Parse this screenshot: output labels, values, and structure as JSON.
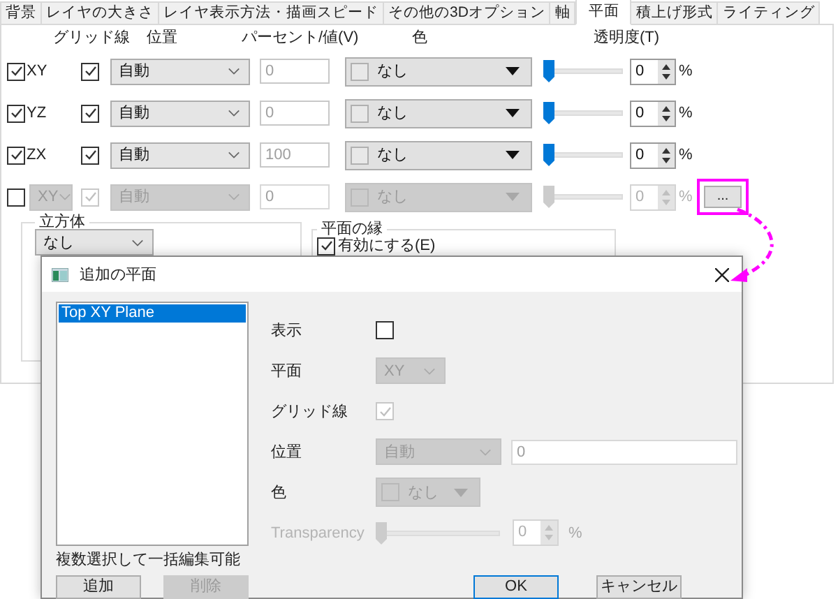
{
  "tabs": [
    {
      "label": "背景",
      "selected": false
    },
    {
      "label": "レイヤの大きさ",
      "selected": false
    },
    {
      "label": "レイヤ表示方法・描画スピード",
      "selected": false
    },
    {
      "label": "その他の3Dオプション",
      "selected": false
    },
    {
      "label": "軸",
      "selected": false
    },
    {
      "label": "平面",
      "selected": true
    },
    {
      "label": "積上げ形式",
      "selected": false
    },
    {
      "label": "ライティング",
      "selected": false
    }
  ],
  "column_headers": [
    "グリッド線",
    "位置",
    "パーセント/値(V)",
    "色",
    "透明度(T)"
  ],
  "planes": [
    {
      "kind": "axis",
      "label": "XY",
      "checked": true,
      "disabled": false,
      "grid_checked": true,
      "position": "自動",
      "value": "0",
      "color_value": "なし",
      "level": 0,
      "transparency": "0",
      "unit": "%"
    },
    {
      "kind": "axis",
      "label": "YZ",
      "checked": true,
      "disabled": false,
      "grid_checked": true,
      "position": "自動",
      "value": "0",
      "color_value": "なし",
      "level": 0,
      "transparency": "0",
      "unit": "%"
    },
    {
      "kind": "axis",
      "label": "ZX",
      "checked": true,
      "disabled": false,
      "grid_checked": true,
      "position": "自動",
      "value": "100",
      "color_value": "なし",
      "level": 0,
      "transparency": "0",
      "unit": "%"
    },
    {
      "kind": "extra",
      "label": "XY",
      "checked": false,
      "disabled": true,
      "grid_checked": true,
      "position": "自動",
      "value": "0",
      "color_value": "なし",
      "level": 0,
      "transparency": "0",
      "unit": "%",
      "more_button": {
        "label": "...",
        "highlighted": true
      }
    }
  ],
  "cube_group": {
    "title": "立方体",
    "value": "なし"
  },
  "edge_group": {
    "title": "平面の縁",
    "checkbox": {
      "label": "有効にする(E)",
      "checked": true
    }
  },
  "dialog": {
    "title": "追加の平面",
    "list": [
      {
        "label": "Top XY Plane",
        "selected": true
      }
    ],
    "hint": "複数選択して一括編集可能",
    "add_button": {
      "label": "追加",
      "disabled": false
    },
    "delete_button": {
      "label": "削除",
      "disabled": true
    },
    "fields": [
      {
        "kind": "checkbox",
        "label": "表示",
        "checked": false,
        "disabled": false
      },
      {
        "kind": "select",
        "label": "平面",
        "value": "XY",
        "disabled": true
      },
      {
        "kind": "checkbox",
        "label": "グリッド線",
        "checked": true,
        "disabled": true
      },
      {
        "kind": "select_input",
        "label": "位置",
        "value": "自動",
        "input": "0",
        "disabled": true
      },
      {
        "kind": "color",
        "label": "色",
        "value": "なし",
        "disabled": true
      },
      {
        "kind": "slider",
        "label": "Transparency",
        "level": 0,
        "value": "0",
        "unit": "%",
        "disabled": true
      }
    ],
    "ok_button": "OK",
    "cancel_button": "キャンセル"
  }
}
